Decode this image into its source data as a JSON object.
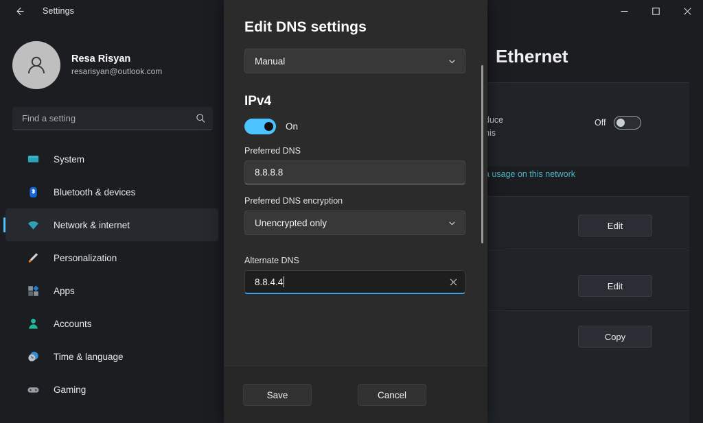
{
  "titlebar": {
    "back_icon": "back-arrow-icon",
    "label": "Settings",
    "minimize": "─",
    "maximize": "□",
    "close": "✕"
  },
  "sidebar": {
    "account": {
      "name": "Resa Risyan",
      "email": "resarisyan@outlook.com",
      "avatar_icon": "user-avatar-icon"
    },
    "search": {
      "placeholder": "Find a setting",
      "icon": "search-icon"
    },
    "items": [
      {
        "label": "System",
        "icon": "monitor-icon",
        "selected": false
      },
      {
        "label": "Bluetooth & devices",
        "icon": "bluetooth-icon",
        "selected": false
      },
      {
        "label": "Network & internet",
        "icon": "wifi-icon",
        "selected": true
      },
      {
        "label": "Personalization",
        "icon": "brush-icon",
        "selected": false
      },
      {
        "label": "Apps",
        "icon": "apps-icon",
        "selected": false
      },
      {
        "label": "Accounts",
        "icon": "person-icon",
        "selected": false
      },
      {
        "label": "Time & language",
        "icon": "clock-icon",
        "selected": false
      },
      {
        "label": "Gaming",
        "icon": "gamepad-icon",
        "selected": false
      }
    ]
  },
  "content": {
    "page_title": "Ethernet",
    "metered_row": {
      "description_line1": "duce",
      "description_line2": "his",
      "toggle_label": "Off",
      "toggle_state": "off"
    },
    "data_link": "a usage on this network",
    "buttons": [
      {
        "label": "Edit"
      },
      {
        "label": "Edit"
      },
      {
        "label": "Copy"
      }
    ]
  },
  "dialog": {
    "title": "Edit DNS settings",
    "assignment": {
      "value": "Manual",
      "chevron_icon": "chevron-down-icon"
    },
    "ipv4": {
      "heading": "IPv4",
      "toggle_label": "On",
      "toggle_state": "on"
    },
    "preferred_dns": {
      "label": "Preferred DNS",
      "value": "8.8.8.8"
    },
    "preferred_encryption": {
      "label": "Preferred DNS encryption",
      "value": "Unencrypted only",
      "chevron_icon": "chevron-down-icon"
    },
    "alternate_dns": {
      "label": "Alternate DNS",
      "value": "8.8.4.4",
      "clear_icon": "close-icon",
      "focused": true
    },
    "footer": {
      "save_label": "Save",
      "cancel_label": "Cancel"
    }
  },
  "colors": {
    "accent": "#4cc2ff",
    "focus_underline": "#3aa0e8",
    "link": "#4ab5c4",
    "window_bg": "#1b1d21",
    "dialog_bg": "#2b2b2b",
    "card_bg": "#202429"
  }
}
